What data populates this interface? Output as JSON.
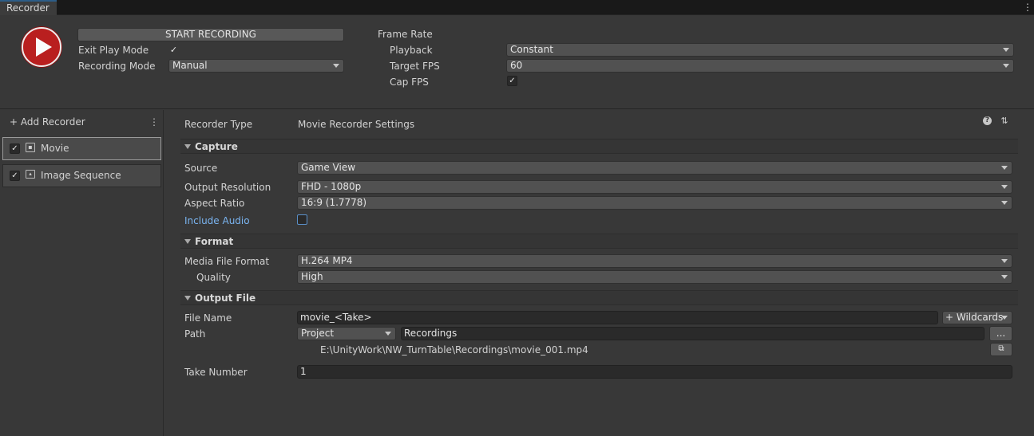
{
  "window": {
    "tab_title": "Recorder",
    "menu_glyph": "⋮"
  },
  "top": {
    "start_button": "START RECORDING",
    "exit_play_mode_label": "Exit Play Mode",
    "exit_play_mode_checked": true,
    "recording_mode_label": "Recording Mode",
    "recording_mode_value": "Manual",
    "frame_rate_label": "Frame Rate",
    "playback_label": "Playback",
    "playback_value": "Constant",
    "target_fps_label": "Target FPS",
    "target_fps_value": "60",
    "cap_fps_label": "Cap FPS",
    "cap_fps_checked": true
  },
  "sidebar": {
    "add_recorder": "+ Add Recorder",
    "items": [
      {
        "label": "Movie",
        "enabled": true,
        "selected": true,
        "icon": "movie-icon"
      },
      {
        "label": "Image Sequence",
        "enabled": true,
        "selected": false,
        "icon": "image-icon"
      }
    ]
  },
  "settings": {
    "recorder_type_label": "Recorder Type",
    "recorder_type_value": "Movie Recorder Settings",
    "capture": {
      "header": "Capture",
      "source_label": "Source",
      "source_value": "Game View",
      "output_resolution_label": "Output Resolution",
      "output_resolution_value": "FHD - 1080p",
      "aspect_ratio_label": "Aspect Ratio",
      "aspect_ratio_value": "16:9 (1.7778)",
      "include_audio_label": "Include Audio",
      "include_audio_checked": false
    },
    "format": {
      "header": "Format",
      "media_file_format_label": "Media File Format",
      "media_file_format_value": "H.264 MP4",
      "quality_label": "Quality",
      "quality_value": "High"
    },
    "output_file": {
      "header": "Output File",
      "file_name_label": "File Name",
      "file_name_value": "movie_<Take>",
      "wildcards_button": "+ Wildcards",
      "path_label": "Path",
      "path_root_value": "Project",
      "path_value": "Recordings",
      "browse_button": "...",
      "full_path": "E:\\UnityWork\\NW_TurnTable\\Recordings\\movie_001.mp4",
      "take_number_label": "Take Number",
      "take_number_value": "1"
    }
  },
  "colors": {
    "accent": "#2c5d87",
    "record_red": "#b91f1f",
    "link_blue": "#7ab4f0"
  }
}
